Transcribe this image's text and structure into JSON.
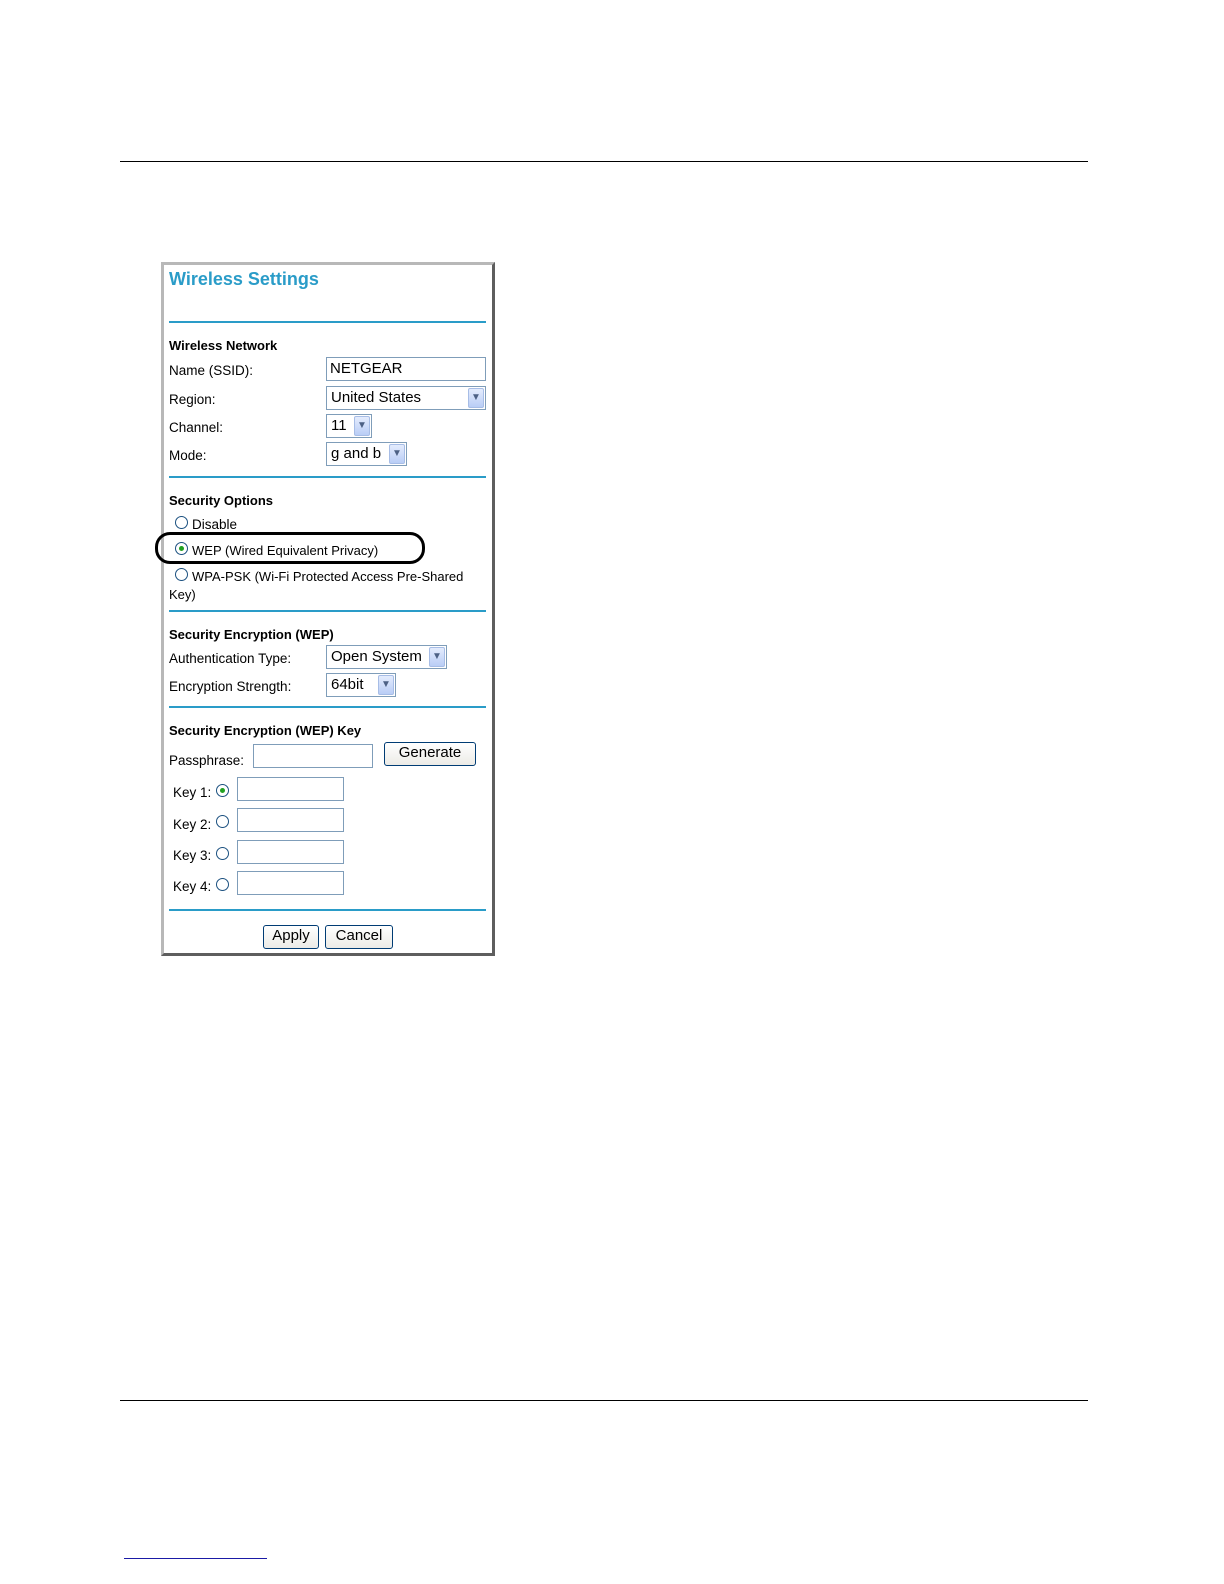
{
  "panel": {
    "title": "Wireless Settings",
    "wireless_network": {
      "heading": "Wireless Network",
      "ssid_label": "Name (SSID):",
      "ssid_value": "NETGEAR",
      "region_label": "Region:",
      "region_value": "United States",
      "channel_label": "Channel:",
      "channel_value": "11",
      "mode_label": "Mode:",
      "mode_value": "g and b"
    },
    "security_options": {
      "heading": "Security Options",
      "disable_label": "Disable",
      "wep_label": "WEP (Wired Equivalent Privacy)",
      "wpa_label_line1": "WPA-PSK (Wi-Fi Protected Access Pre-Shared",
      "wpa_label_line2": "Key)",
      "selected": "WEP (Wired Equivalent Privacy)"
    },
    "wep_encryption": {
      "heading": "Security Encryption (WEP)",
      "auth_label": "Authentication Type:",
      "auth_value": "Open System",
      "strength_label": "Encryption Strength:",
      "strength_value": "64bit"
    },
    "wep_key": {
      "heading": "Security Encryption (WEP) Key",
      "passphrase_label": "Passphrase:",
      "passphrase_value": "",
      "generate_label": "Generate",
      "key1_label": "Key 1:",
      "key2_label": "Key 2:",
      "key3_label": "Key 3:",
      "key4_label": "Key 4:",
      "selected_key": "Key 1:"
    },
    "buttons": {
      "apply_label": "Apply",
      "cancel_label": "Cancel"
    }
  },
  "colors": {
    "accent": "#2a9cc8",
    "radio_dot": "#21a121",
    "input_border": "#7f9db9"
  },
  "icons": {
    "dropdown": "chevron-down-icon"
  }
}
